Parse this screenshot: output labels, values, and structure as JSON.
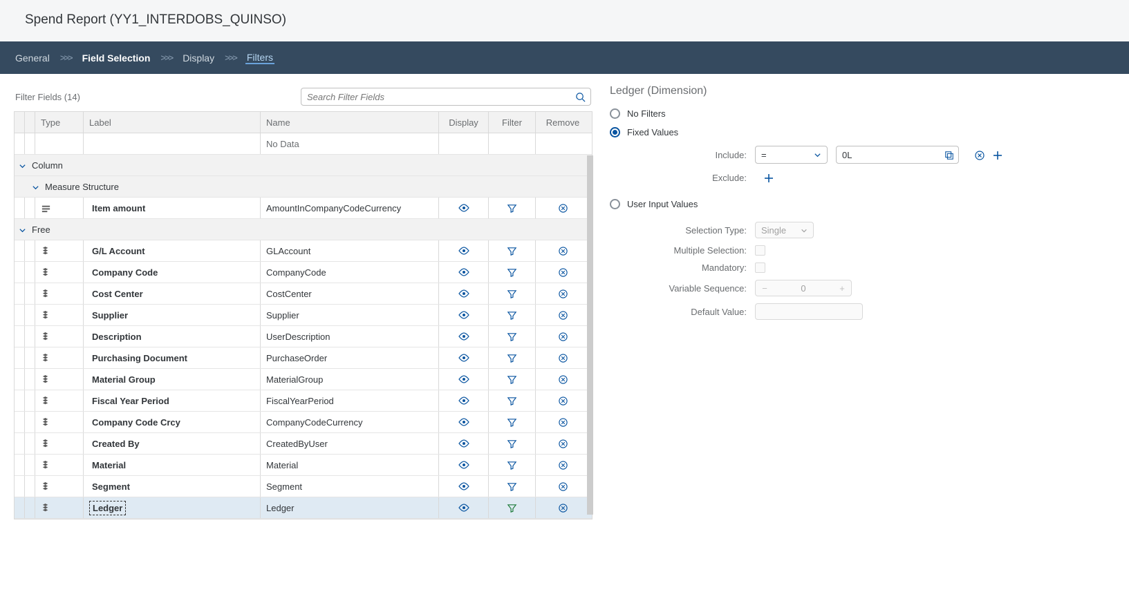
{
  "page_title": "Spend Report (YY1_INTERDOBS_QUINSO)",
  "nav": {
    "items": [
      "General",
      "Field Selection",
      "Display",
      "Filters"
    ],
    "active_index": 3,
    "current_index": 1
  },
  "filter_panel": {
    "title": "Filter Fields (14)",
    "search_placeholder": "Search Filter Fields",
    "columns": {
      "type": "Type",
      "label": "Label",
      "name": "Name",
      "display": "Display",
      "filter": "Filter",
      "remove": "Remove"
    },
    "no_data": "No Data",
    "groups": [
      {
        "label": "Column",
        "sub": "Measure Structure"
      },
      {
        "label": "Free"
      }
    ],
    "rows": [
      {
        "group": 0,
        "label": "Item amount",
        "name": "AmountInCompanyCodeCurrency",
        "icon": "measure"
      },
      {
        "group": 1,
        "label": "G/L Account",
        "name": "GLAccount",
        "icon": "dim"
      },
      {
        "group": 1,
        "label": "Company Code",
        "name": "CompanyCode",
        "icon": "dim"
      },
      {
        "group": 1,
        "label": "Cost Center",
        "name": "CostCenter",
        "icon": "dim"
      },
      {
        "group": 1,
        "label": "Supplier",
        "name": "Supplier",
        "icon": "dim"
      },
      {
        "group": 1,
        "label": "Description",
        "name": "UserDescription",
        "icon": "dim"
      },
      {
        "group": 1,
        "label": "Purchasing Document",
        "name": "PurchaseOrder",
        "icon": "dim"
      },
      {
        "group": 1,
        "label": "Material Group",
        "name": "MaterialGroup",
        "icon": "dim"
      },
      {
        "group": 1,
        "label": "Fiscal Year Period",
        "name": "FiscalYearPeriod",
        "icon": "dim"
      },
      {
        "group": 1,
        "label": "Company Code Crcy",
        "name": "CompanyCodeCurrency",
        "icon": "dim"
      },
      {
        "group": 1,
        "label": "Created By",
        "name": "CreatedByUser",
        "icon": "dim"
      },
      {
        "group": 1,
        "label": "Material",
        "name": "Material",
        "icon": "dim"
      },
      {
        "group": 1,
        "label": "Segment",
        "name": "Segment",
        "icon": "dim"
      },
      {
        "group": 1,
        "label": "Ledger",
        "name": "Ledger",
        "icon": "dim",
        "selected": true,
        "filter_active": true
      }
    ]
  },
  "detail": {
    "title": "Ledger (Dimension)",
    "radios": {
      "no_filters": "No Filters",
      "fixed_values": "Fixed Values",
      "user_input": "User Input Values",
      "selected": "fixed_values"
    },
    "include_label": "Include:",
    "exclude_label": "Exclude:",
    "operator": "=",
    "value": "0L",
    "selection_type_label": "Selection Type:",
    "selection_type_value": "Single",
    "multiple_label": "Multiple Selection:",
    "mandatory_label": "Mandatory:",
    "variable_seq_label": "Variable Sequence:",
    "variable_seq_value": "0",
    "default_value_label": "Default Value:"
  }
}
